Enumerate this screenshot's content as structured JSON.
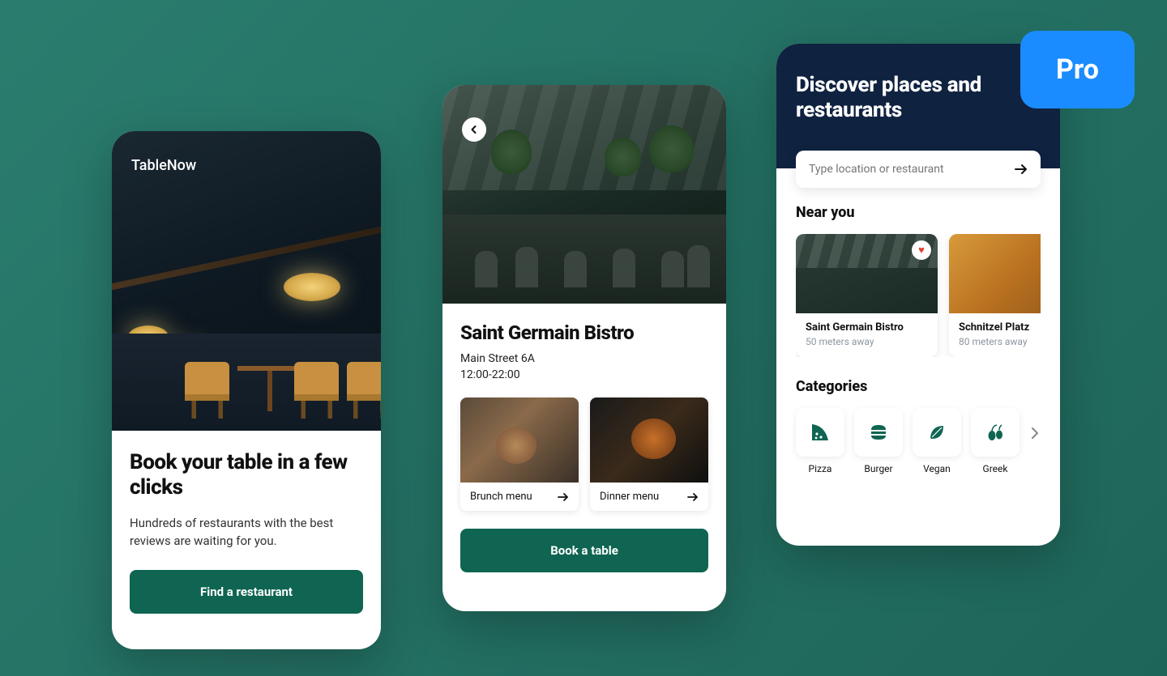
{
  "pro_badge": "Pro",
  "screen1": {
    "brand": "TableNow",
    "title": "Book your table in a few clicks",
    "subtitle": "Hundreds of restaurants with the best reviews are waiting for you.",
    "cta": "Find a restaurant"
  },
  "screen2": {
    "restaurant_name": "Saint Germain Bistro",
    "address": "Main Street 6A",
    "hours": "12:00-22:00",
    "menus": [
      {
        "label": "Brunch menu"
      },
      {
        "label": "Dinner menu"
      }
    ],
    "cta": "Book a table"
  },
  "screen3": {
    "title": "Discover places and restaurants",
    "search_placeholder": "Type location or restaurant",
    "near_you_label": "Near you",
    "near_you": [
      {
        "name": "Saint Germain Bistro",
        "distance": "50 meters away",
        "favorited": true
      },
      {
        "name": "Schnitzel Platz",
        "distance": "80 meters away",
        "favorited": false
      }
    ],
    "categories_label": "Categories",
    "categories": [
      {
        "label": "Pizza",
        "icon": "pizza-icon"
      },
      {
        "label": "Burger",
        "icon": "burger-icon"
      },
      {
        "label": "Vegan",
        "icon": "leaf-icon"
      },
      {
        "label": "Greek",
        "icon": "olives-icon"
      }
    ]
  }
}
